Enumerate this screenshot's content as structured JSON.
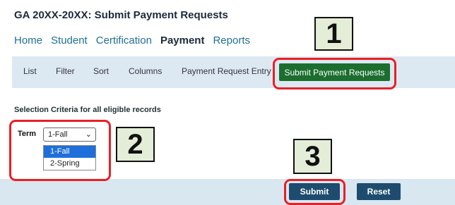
{
  "app": {
    "title": "GA 20XX-20XX: Submit Payment Requests"
  },
  "main_nav": {
    "home": "Home",
    "student": "Student",
    "certification": "Certification",
    "payment": "Payment",
    "reports": "Reports"
  },
  "toolbar": {
    "list": "List",
    "filter": "Filter",
    "sort": "Sort",
    "columns": "Columns",
    "payment_request_entry": "Payment Request Entry",
    "submit_payment_requests": "Submit Payment Requests"
  },
  "criteria": {
    "heading": "Selection Criteria for all eligible records",
    "term_label": "Term",
    "term_selected": "1-Fall",
    "term_options": [
      "1-Fall",
      "2-Spring"
    ]
  },
  "actions": {
    "submit": "Submit",
    "reset": "Reset"
  },
  "callouts": {
    "one": "1",
    "two": "2",
    "three": "3"
  },
  "colors": {
    "accent_green": "#1b6e2e",
    "action_button": "#1e4c6e",
    "callout_red": "#ea1f24",
    "callout_fill": "#e4edd7"
  }
}
